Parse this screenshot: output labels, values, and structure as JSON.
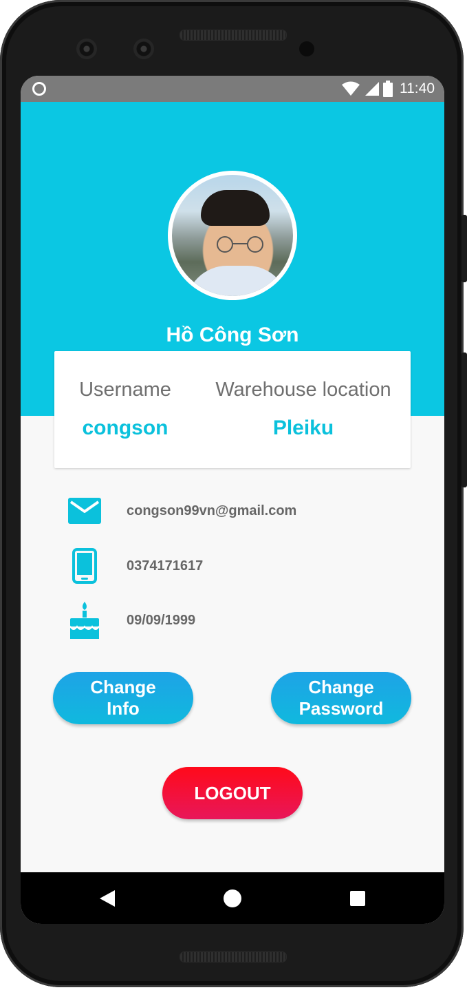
{
  "status_bar": {
    "time": "11:40"
  },
  "profile": {
    "name": "Hồ Công Sơn"
  },
  "info_card": {
    "username_label": "Username",
    "username_value": "congson",
    "location_label": "Warehouse location",
    "location_value": "Pleiku"
  },
  "details": {
    "email": "congson99vn@gmail.com",
    "phone": "0374171617",
    "birthday": "09/09/1999"
  },
  "buttons": {
    "change_info_line1": "Change",
    "change_info_line2": "Info",
    "change_password_line1": "Change",
    "change_password_line2": "Password",
    "logout": "LOGOUT"
  },
  "icons": {
    "status": [
      "circle-icon",
      "wifi-icon",
      "signal-icon",
      "battery-icon"
    ],
    "details": [
      "email-icon",
      "phone-icon",
      "birthday-cake-icon"
    ],
    "nav": [
      "back-icon",
      "home-icon",
      "recents-icon"
    ]
  },
  "colors": {
    "accent": "#0bc7e3",
    "button_blue": "#1ea3e6",
    "logout_red": "#ff0a1a",
    "background": "#f8f8f8"
  }
}
